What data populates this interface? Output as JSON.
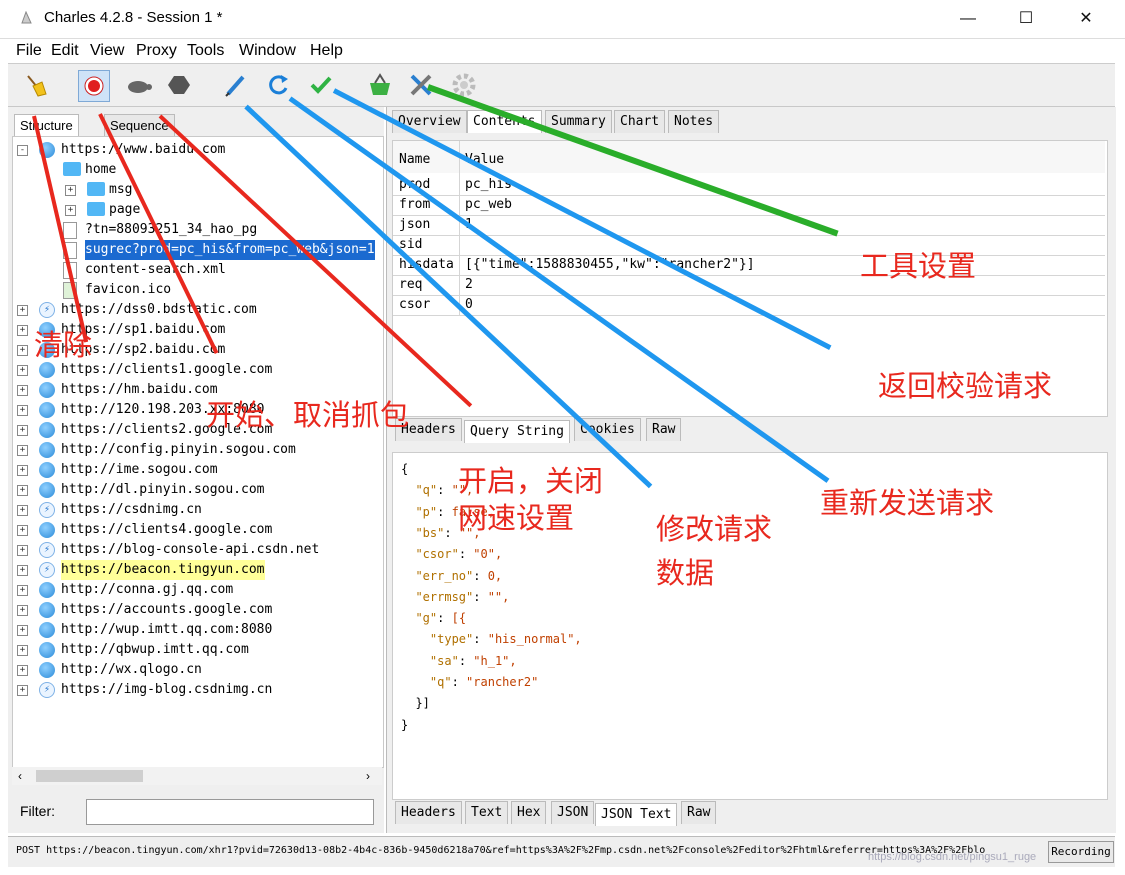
{
  "window": {
    "title": "Charles 4.2.8 - Session 1 *",
    "controls": [
      "—",
      "☐",
      "✕"
    ]
  },
  "menu": [
    "File",
    "Edit",
    "View",
    "Proxy",
    "Tools",
    "Window",
    "Help"
  ],
  "left_tabs": [
    "Structure",
    "Sequence"
  ],
  "tree": [
    {
      "label": "https://www.baidu.com",
      "icon": "globe"
    },
    {
      "label": "home",
      "icon": "folder"
    },
    {
      "label": "msg",
      "icon": "folder"
    },
    {
      "label": "page",
      "icon": "folder"
    },
    {
      "label": "?tn=88093251_34_hao_pg",
      "icon": "doc"
    },
    {
      "label": "sugrec?prod=pc_his&from=pc_web&json=1",
      "icon": "doc"
    },
    {
      "label": "content-search.xml",
      "icon": "doc"
    },
    {
      "label": "favicon.ico",
      "icon": "image"
    },
    {
      "label": "https://dss0.bdstatic.com",
      "icon": "lock"
    },
    {
      "label": "https://sp1.baidu.com",
      "icon": "globe"
    },
    {
      "label": "https://sp2.baidu.com",
      "icon": "globe"
    },
    {
      "label": "https://clients1.google.com",
      "icon": "globe"
    },
    {
      "label": "https://hm.baidu.com",
      "icon": "globe"
    },
    {
      "label": "http://120.198.203.xx:8080",
      "icon": "globe"
    },
    {
      "label": "https://clients2.google.com",
      "icon": "globe"
    },
    {
      "label": "http://config.pinyin.sogou.com",
      "icon": "globe"
    },
    {
      "label": "http://ime.sogou.com",
      "icon": "globe"
    },
    {
      "label": "http://dl.pinyin.sogou.com",
      "icon": "globe"
    },
    {
      "label": "https://csdnimg.cn",
      "icon": "lock"
    },
    {
      "label": "https://clients4.google.com",
      "icon": "globe"
    },
    {
      "label": "https://blog-console-api.csdn.net",
      "icon": "lock"
    },
    {
      "label": "https://beacon.tingyun.com",
      "icon": "lock"
    },
    {
      "label": "http://conna.gj.qq.com",
      "icon": "globe"
    },
    {
      "label": "https://accounts.google.com",
      "icon": "globe"
    },
    {
      "label": "http://wup.imtt.qq.com:8080",
      "icon": "globe"
    },
    {
      "label": "http://qbwup.imtt.qq.com",
      "icon": "globe"
    },
    {
      "label": "http://wx.qlogo.cn",
      "icon": "globe"
    },
    {
      "label": "https://img-blog.csdnimg.cn",
      "icon": "lock"
    }
  ],
  "filter_label": "Filter:",
  "right_tabs": [
    "Overview",
    "Contents",
    "Summary",
    "Chart",
    "Notes"
  ],
  "table": {
    "headers": [
      "Name",
      "Value"
    ],
    "rows": [
      [
        "prod",
        "pc_his"
      ],
      [
        "from",
        "pc_web"
      ],
      [
        "json",
        "1"
      ],
      [
        "sid",
        ""
      ],
      [
        "hisdata",
        "[{\"time\":1588830455,\"kw\":\"rancher2\"}]"
      ],
      [
        "req",
        "2"
      ],
      [
        "csor",
        "0"
      ]
    ]
  },
  "req_tabs": [
    "Headers",
    "Query String",
    "Cookies",
    "Raw"
  ],
  "json_lines": [
    "{",
    "  \"q\": \"\",",
    "  \"p\": false,",
    "  \"bs\": \"\",",
    "  \"csor\": \"0\",",
    "  \"err_no\": 0,",
    "  \"errmsg\": \"\",",
    "  \"g\": [{",
    "    \"type\": \"his_normal\",",
    "    \"sa\": \"h_1\",",
    "    \"q\": \"rancher2\"",
    "  }]",
    "}"
  ],
  "resp_tabs": [
    "Headers",
    "Text",
    "Hex",
    "JSON",
    "JSON Text",
    "Raw"
  ],
  "status": "POST https://beacon.tingyun.com/xhr1?pvid=72630d13-08b2-4b4c-836b-9450d6218a70&ref=https%3A%2F%2Fmp.csdn.net%2Fconsole%2Feditor%2Fhtml&referrer=https%3A%2F%2Fblo",
  "recording": "Recording",
  "watermark": "https://blog.csdn.net/pingsu1_ruge",
  "annotations": {
    "clear": "清除",
    "start_stop": "开始、取消抓包",
    "throttle": "开启，关闭\n网速设置",
    "edit": "修改请求\n数据",
    "repeat": "重新发送请求",
    "validate": "返回校验请求",
    "tools": "工具设置"
  },
  "colors": {
    "selection": "#1b6ad0",
    "highlight": "#ffff99",
    "annotation_red": "#e8281e",
    "annotation_blue": "#1f97ef",
    "annotation_green": "#2aad2a"
  }
}
